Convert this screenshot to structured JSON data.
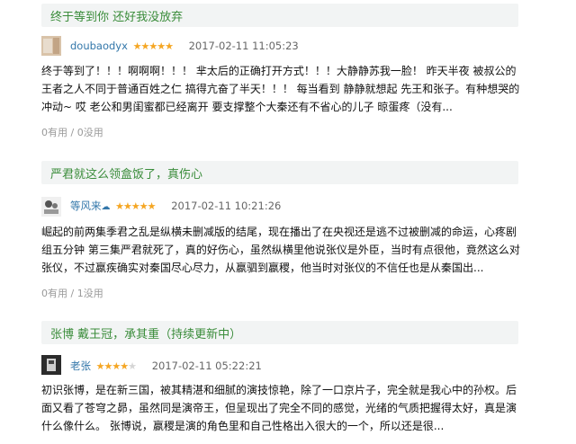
{
  "reviews": [
    {
      "title": "终于等到你 还好我没放弃",
      "user": "doubaodyx",
      "user_icon": "",
      "rating": 5,
      "time": "2017-02-11 11:05:23",
      "text": "终于等到了！！！啊啊啊！！！ 芈太后的正确打开方式！！！大静静苏我一脸！ 昨天半夜 被叔公的 王者之人不同于普通百姓之仁 搞得亢奋了半天！！！ 每当看到 静静就想起 先王和张子。有种想哭的冲动~ 哎 老公和男闺蜜都已经离开 要支撑整个大秦还有不省心的儿子 晾蛋疼（没有...",
      "votes": "0有用 / 0没用"
    },
    {
      "title": "严君就这么领盒饭了，真伤心",
      "user": "等风来",
      "user_icon": "☁",
      "rating": 5,
      "time": "2017-02-11 10:21:26",
      "text": "崛起的前两集季君之乱是纵横未删减版的结尾，现在播出了在央视还是逃不过被删减的命运，心疼剧组五分钟 第三集严君就死了，真的好伤心，虽然纵横里他说张仪是外臣，当时有点很他，竟然这么对张仪，不过嬴疾确实对秦国尽心尽力，从嬴驷到嬴稷，他当时对张仪的不信任也是从秦国出...",
      "votes": "0有用 / 1没用"
    },
    {
      "title": "张博 戴王冠，承其重（持续更新中）",
      "user": "老张",
      "user_icon": "",
      "rating": 4,
      "time": "2017-02-11 05:22:21",
      "text": "初识张博，是在新三国，被其精湛和细腻的演技惊艳，除了一口京片子，完全就是我心中的孙权。后面又看了苍穹之昴，虽然同是演帝王，但呈现出了完全不同的感觉，光绪的气质把握得太好，真是演什么像什么。 张博说，嬴稷是演的角色里和自己性格出入很大的一个，所以还是很...",
      "votes": ""
    }
  ],
  "colors": {
    "title_green": "#3a8c3a",
    "title_bg": "#f2f4f4",
    "user_blue": "#3377aa",
    "star_orange": "#f5a623",
    "star_empty": "#d5d5d5"
  },
  "icons": [
    "avatar-image",
    "star-icon",
    "cloud-icon"
  ]
}
